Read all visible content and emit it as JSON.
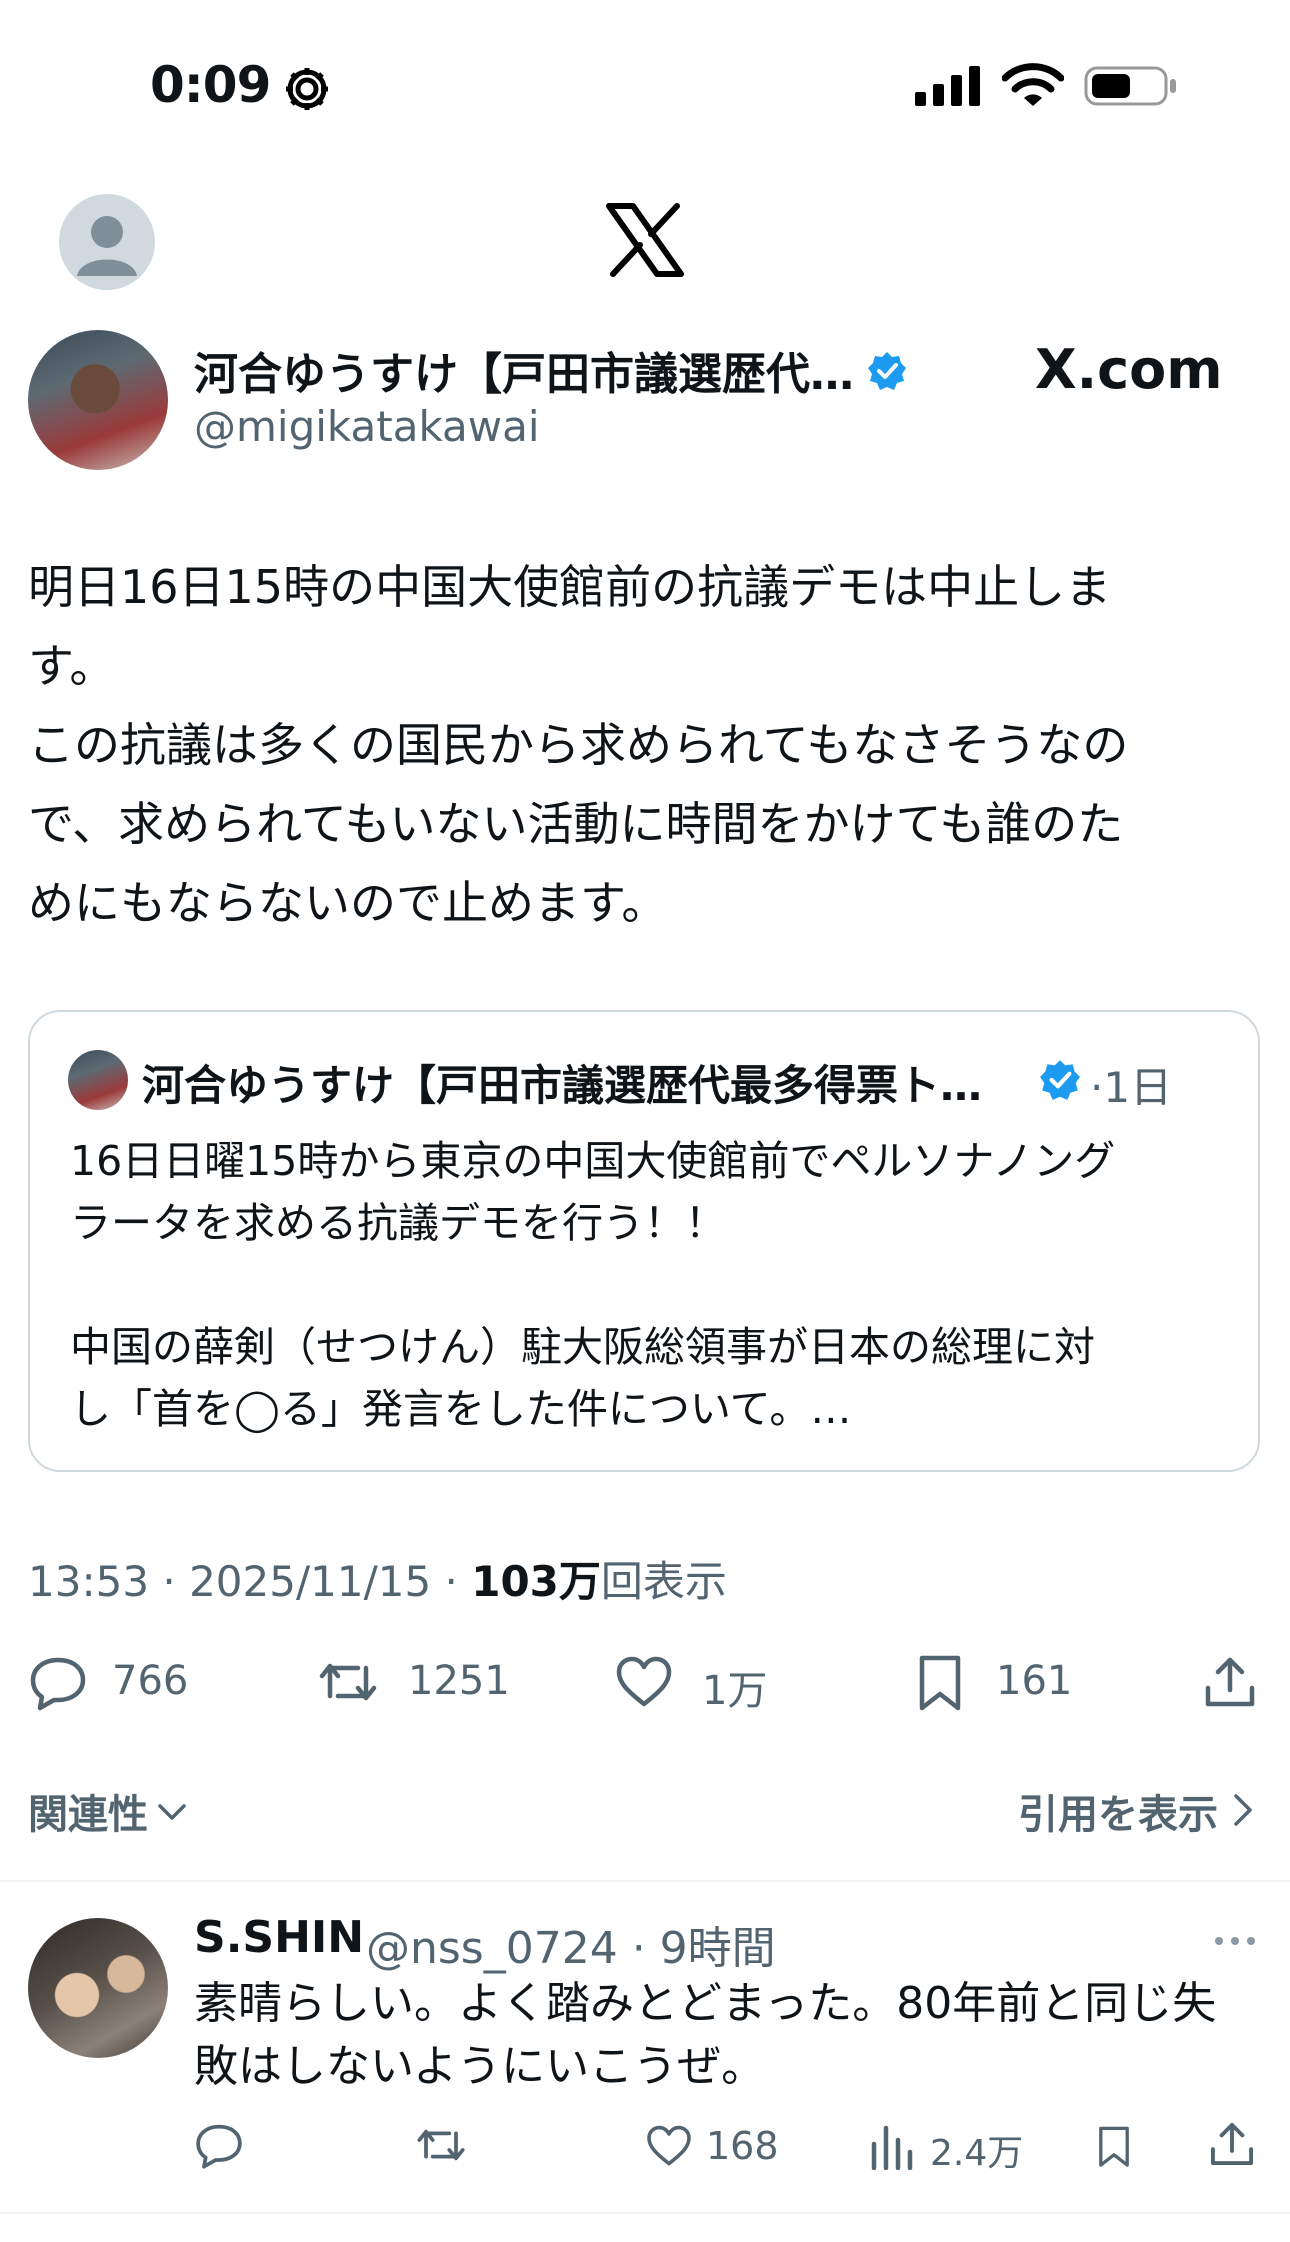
{
  "status_bar": {
    "time": "0:09"
  },
  "header": {
    "logo": "x-logo-icon"
  },
  "tweet": {
    "author_name": "河合ゆうすけ【戸田市議選歴代…",
    "author_handle": "@migikatakawai",
    "watermark": "X.com",
    "body": "明日16日15時の中国大使館前の抗議デモは中止しま\nす。\nこの抗議は多くの国民から求められてもなさそうなの\nで、求められてもいない活動に時間をかけても誰のた\nめにもならないので止めます。",
    "quote": {
      "author_name": "河合ゆうすけ【戸田市議選歴代最多得票ト…",
      "time": "·1日",
      "text": "16日日曜15時から東京の中国大使館前でペルソナノング\nラータを求める抗議デモを行う！！\n\n中国の薛剣（せつけん）駐大阪総領事が日本の総理に対\nし「首を◯る」発言をした件について。…"
    },
    "meta": {
      "time_date": "13:53 · 2025/11/15 · ",
      "views_count": "103万",
      "views_label": "回表示"
    },
    "actions": {
      "replies": "766",
      "reposts": "1251",
      "likes": "1万",
      "bookmarks": "161"
    }
  },
  "replies_header": {
    "sort_label": "関連性",
    "quotes_label": "引用を表示"
  },
  "reply": {
    "name": "S.SHIN",
    "handle_time": "@nss_0724 · 9時間",
    "text": "素晴らしい。よく踏みとどまった。80年前と同じ失\n敗はしないようにいこうぜ。",
    "likes": "168",
    "views": "2.4万"
  },
  "colors": {
    "text": "#0f1419",
    "secondary": "#536471",
    "verified": "#1d9bf0",
    "border": "#cfd9de"
  }
}
